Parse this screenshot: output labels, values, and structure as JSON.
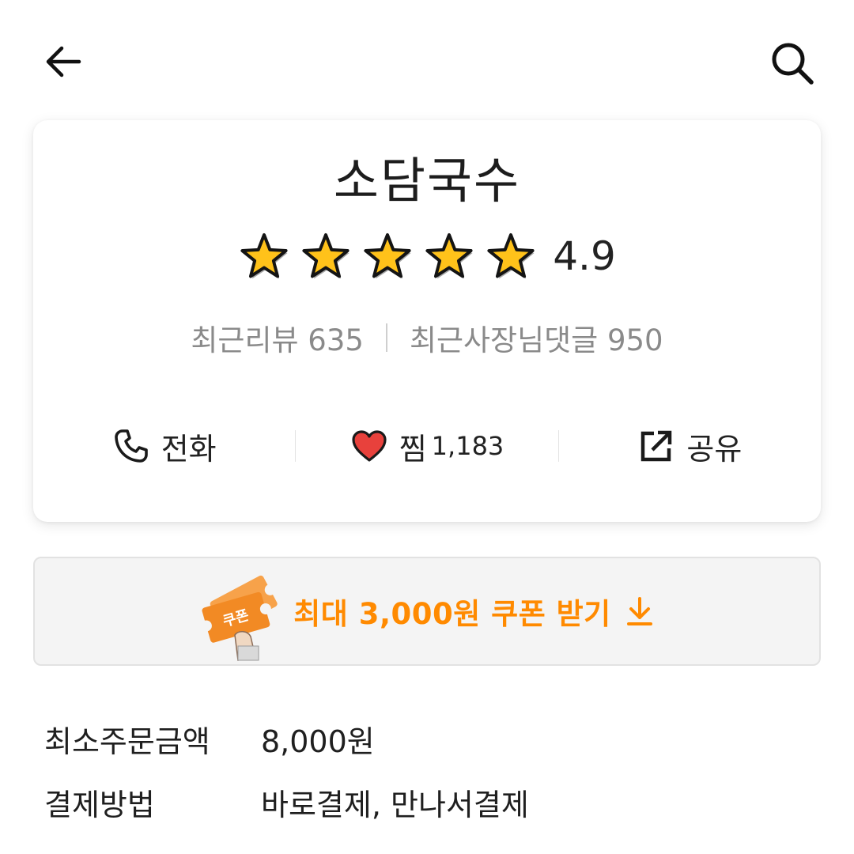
{
  "nav": {
    "back_icon": "arrow-left-icon",
    "search_icon": "search-icon"
  },
  "store": {
    "name": "소담국수",
    "rating_stars": 5,
    "rating": "4.9",
    "recent_reviews": "최근리뷰 635",
    "recent_owner_replies": "최근사장님댓글 950"
  },
  "actions": {
    "call": {
      "label": "전화",
      "icon": "phone-icon"
    },
    "like": {
      "label": "찜",
      "count": "1,183",
      "icon": "heart-icon",
      "color": "#e8413c"
    },
    "share": {
      "label": "공유",
      "icon": "share-icon"
    }
  },
  "coupon": {
    "badge_text": "쿠폰",
    "text": "최대 3,000원 쿠폰 받기",
    "accent": "#ff8a00",
    "icon": "download-arrow-icon"
  },
  "info": {
    "min_order_label": "최소주문금액",
    "min_order_value": "8,000원",
    "payment_label": "결제방법",
    "payment_value": "바로결제, 만나서결제"
  }
}
